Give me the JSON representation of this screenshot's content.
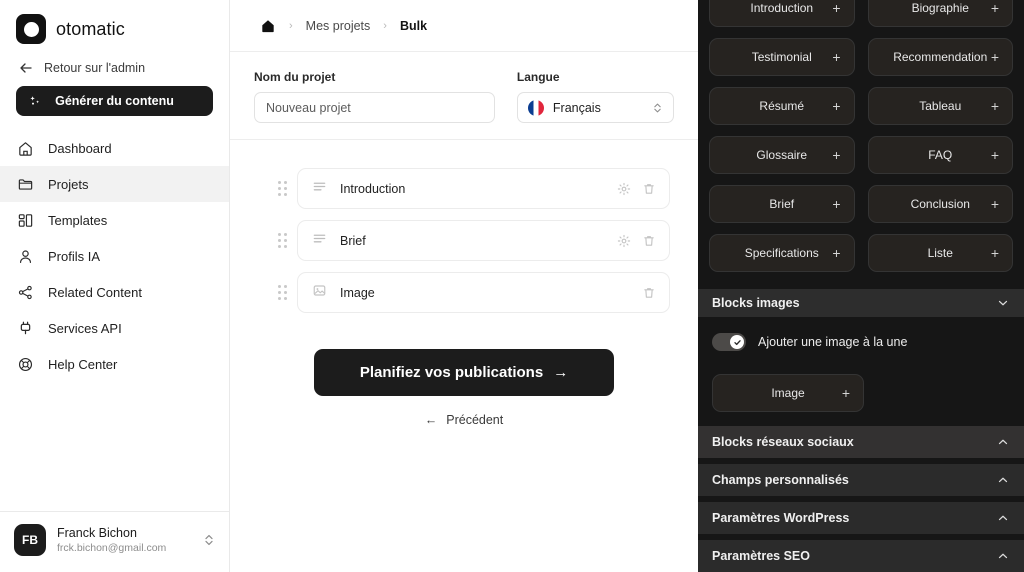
{
  "brand": {
    "name": "otomatic",
    "logo_icon": "circle-logo-icon"
  },
  "sidebar": {
    "back_label": "Retour sur l'admin",
    "generate_label": "Générer du contenu",
    "items": [
      {
        "label": "Dashboard",
        "icon": "home-icon",
        "active": false
      },
      {
        "label": "Projets",
        "icon": "folder-icon",
        "active": true
      },
      {
        "label": "Templates",
        "icon": "templates-icon",
        "active": false
      },
      {
        "label": "Profils IA",
        "icon": "user-icon",
        "active": false
      },
      {
        "label": "Related Content",
        "icon": "share-icon",
        "active": false
      },
      {
        "label": "Services API",
        "icon": "plug-icon",
        "active": false
      },
      {
        "label": "Help Center",
        "icon": "lifebuoy-icon",
        "active": false
      }
    ],
    "user": {
      "initials": "FB",
      "name": "Franck Bichon",
      "email": "frck.bichon@gmail.com"
    }
  },
  "breadcrumb": {
    "home_icon": "home-icon",
    "items": [
      "Mes projets",
      "Bulk"
    ],
    "separator": "›"
  },
  "form": {
    "project_name_label": "Nom du projet",
    "project_name_value": "Nouveau projet",
    "language_label": "Langue",
    "language_value": "Français",
    "language_flag": "flag-france-icon"
  },
  "blocks": [
    {
      "label": "Introduction",
      "icon": "text-lines-icon",
      "has_settings": true,
      "has_delete": true
    },
    {
      "label": "Brief",
      "icon": "text-lines-icon",
      "has_settings": true,
      "has_delete": true
    },
    {
      "label": "Image",
      "icon": "image-icon",
      "has_settings": false,
      "has_delete": true
    }
  ],
  "actions": {
    "primary_label": "Planifiez vos publications",
    "primary_arrow": "→",
    "back_label": "Précédent",
    "back_arrow": "←"
  },
  "panel": {
    "chips": [
      "Introduction",
      "Biographie",
      "Testimonial",
      "Recommendation",
      "Résumé",
      "Tableau",
      "Glossaire",
      "FAQ",
      "Brief",
      "Conclusion",
      "Specifications",
      "Liste"
    ],
    "chip_add_symbol": "+",
    "images_section": {
      "title": "Blocks images",
      "chevron": "chevron-down-icon",
      "toggle_label": "Ajouter une image à la une",
      "toggle_on": true,
      "image_chip": "Image"
    },
    "sections": [
      {
        "title": "Blocks réseaux sociaux",
        "chevron": "chevron-up-icon"
      },
      {
        "title": "Champs personnalisés",
        "chevron": "chevron-up-icon"
      },
      {
        "title": "Paramètres WordPress",
        "chevron": "chevron-up-icon"
      },
      {
        "title": "Paramètres SEO",
        "chevron": "chevron-up-icon"
      }
    ]
  },
  "colors": {
    "dark": "#1c1c1c",
    "panel_bg": "#161616",
    "chip_bg": "#262320",
    "active_nav": "#f2f2f2"
  }
}
